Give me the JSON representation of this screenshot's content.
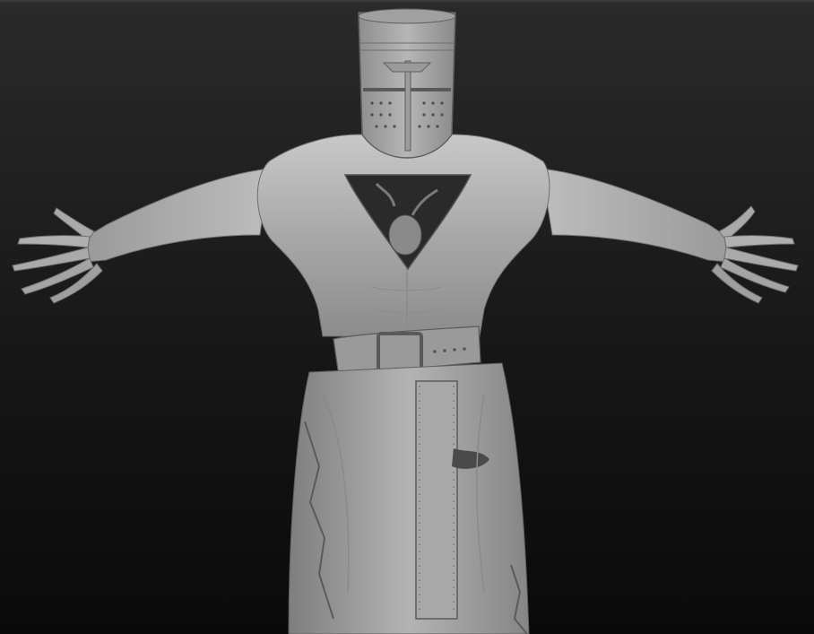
{
  "scene": {
    "subject": "sculpt-model",
    "material_color": "#a9a9a9",
    "background_top": "#2a2a2a",
    "background_bottom": "#0a0a0a"
  }
}
